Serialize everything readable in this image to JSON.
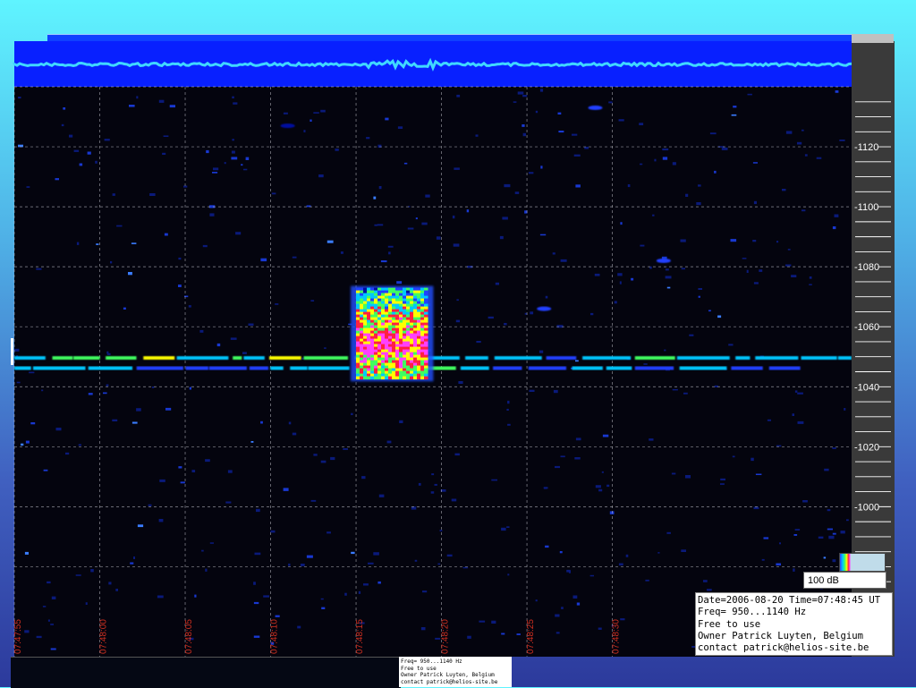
{
  "chart_data": {
    "type": "heatmap",
    "title": "",
    "xlabel": "",
    "ylabel": "",
    "x_range": [
      "07:47:55",
      "07:48:44"
    ],
    "ylim": [
      950,
      1140
    ],
    "x_ticks": [
      "07:47:55",
      "07:48:00",
      "07:48:05",
      "07:48:10",
      "07:48:15",
      "07:48:20",
      "07:48:25",
      "07:48:30"
    ],
    "y_ticks": [
      1000,
      1020,
      1040,
      1060,
      1080,
      1100,
      1120
    ],
    "grid": true,
    "colormap": [
      "#000010",
      "#0010a0",
      "#2040ff",
      "#00c8ff",
      "#40ff60",
      "#ffff00",
      "#ff2040",
      "#ff40ff"
    ],
    "features": [
      {
        "kind": "carrier",
        "t_start": "07:47:55",
        "t_end": "07:48:44",
        "freq": 1049.6,
        "level": 0.55
      },
      {
        "kind": "carrier",
        "t_start": "07:47:55",
        "t_end": "07:48:41",
        "freq": 1046.2,
        "level": 0.45
      },
      {
        "kind": "burst",
        "t_start": "07:48:15",
        "t_end": "07:48:19",
        "freq_min": 1043,
        "freq_max": 1073,
        "level": 1.0
      },
      {
        "kind": "blob",
        "t": "07:48:11",
        "freq": 1127,
        "level": 0.2
      },
      {
        "kind": "blob",
        "t": "07:48:26",
        "freq": 1066,
        "level": 0.3
      },
      {
        "kind": "blob",
        "t": "07:48:29",
        "freq": 1133,
        "level": 0.3
      },
      {
        "kind": "blob",
        "t": "07:48:33",
        "freq": 1082,
        "level": 0.35
      }
    ]
  },
  "colorbar": {
    "label": "100 dB"
  },
  "info": {
    "line1": "Date=2006-08-20 Time=07:48:45 UT",
    "line2": "Freq= 950...1140 Hz",
    "line3": "Free to use",
    "line4": "Owner Patrick Luyten, Belgium",
    "line5": "contact patrick@helios-site.be"
  },
  "bottom_caption": {
    "line1": "Freq= 950...1140 Hz",
    "line2": "Free to use",
    "line3": "Owner Patrick Luyten, Belgium",
    "line4": "contact patrick@helios-site.be"
  },
  "colors": {
    "plot_bg": "#04040e",
    "top_band": "#0820ff",
    "grid": "#c8c8d0",
    "tick_label_x": "#d03020",
    "axis_panel": "#3a3a3a",
    "carrier": "#30e070"
  }
}
